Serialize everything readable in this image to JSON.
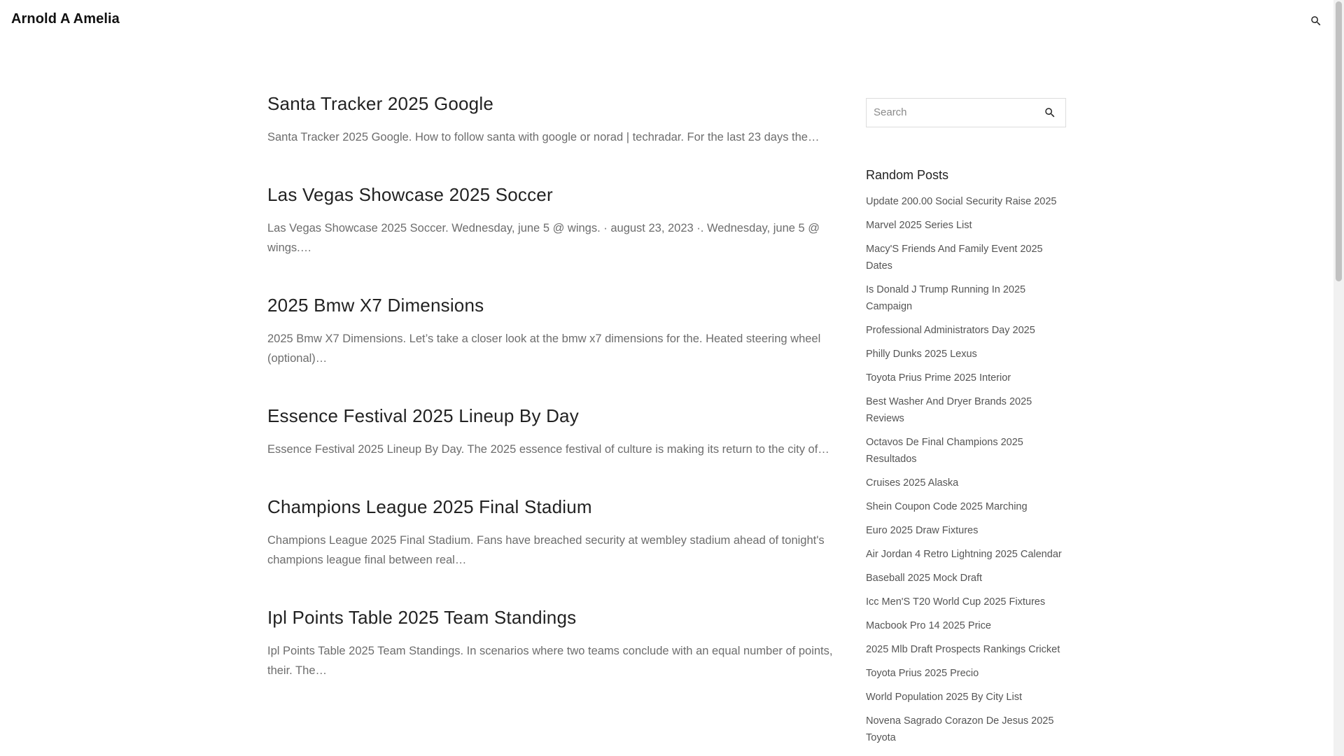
{
  "site": {
    "title": "Arnold A Amelia"
  },
  "icons": {
    "header_search": "search-icon",
    "sidebar_search": "search-icon"
  },
  "posts": [
    {
      "title": "Santa Tracker 2025 Google",
      "excerpt": "Santa Tracker 2025 Google. How to follow santa with google or norad | techradar. For the last 23 days the…"
    },
    {
      "title": "Las Vegas Showcase 2025 Soccer",
      "excerpt": "Las Vegas Showcase 2025 Soccer. Wednesday, june 5 @ wings. · august 23, 2023 ·. Wednesday, june 5 @ wings.…"
    },
    {
      "title": "2025 Bmw X7 Dimensions",
      "excerpt": "2025 Bmw X7 Dimensions. Let’s take a closer look at the bmw x7 dimensions for the. Heated steering wheel (optional)…"
    },
    {
      "title": "Essence Festival 2025 Lineup By Day",
      "excerpt": "Essence Festival 2025 Lineup By Day. The 2025 essence festival of culture is making its return to the city of…"
    },
    {
      "title": "Champions League 2025 Final Stadium",
      "excerpt": "Champions League 2025 Final Stadium. Fans have breached security at wembley stadium ahead of tonight's champions league final between real…"
    },
    {
      "title": "Ipl Points Table 2025 Team Standings",
      "excerpt": "Ipl Points Table 2025 Team Standings. In scenarios where two teams conclude with an equal number of points, their. The…"
    }
  ],
  "sidebar": {
    "search_placeholder": "Search",
    "random_title": "Random Posts",
    "random_posts": [
      "Update 200.00 Social Security Raise 2025",
      "Marvel 2025 Series List",
      "Macy'S Friends And Family Event 2025 Dates",
      "Is Donald J Trump Running In 2025 Campaign",
      "Professional Administrators Day 2025",
      "Philly Dunks 2025 Lexus",
      "Toyota Prius Prime 2025 Interior",
      "Best Washer And Dryer Brands 2025 Reviews",
      "Octavos De Final Champions 2025 Resultados",
      "Cruises 2025 Alaska",
      "Shein Coupon Code 2025 Marching",
      "Euro 2025 Draw Fixtures",
      "Air Jordan 4 Retro Lightning 2025 Calendar",
      "Baseball 2025 Mock Draft",
      "Icc Men'S T20 World Cup 2025 Fixtures",
      "Macbook Pro 14 2025 Price",
      "2025 Mlb Draft Prospects Rankings Cricket",
      "Toyota Prius 2025 Precio",
      "World Population 2025 By City List",
      "Novena Sagrado Corazon De Jesus 2025 Toyota"
    ]
  }
}
